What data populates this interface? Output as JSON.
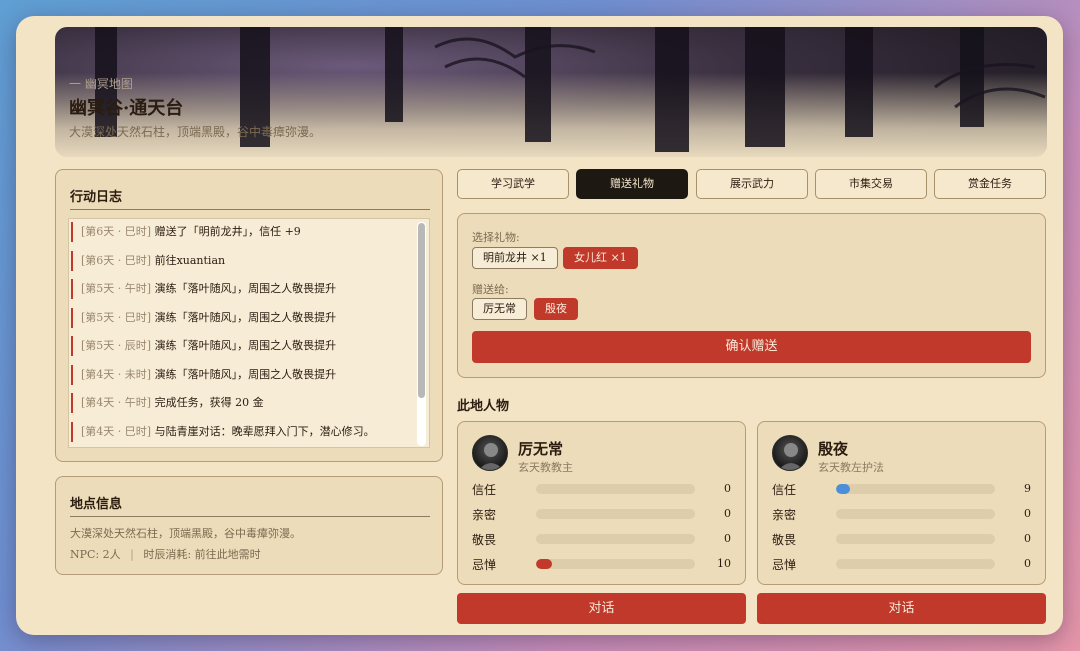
{
  "location": {
    "region": "一 幽冥地图",
    "title": "幽冥谷·通天台",
    "description": "大漠深处天然石柱，顶端黑殿，谷中毒瘴弥漫。"
  },
  "action_log": {
    "title": "行动日志",
    "entries": [
      {
        "time": "[第6天 · 巳时]",
        "text": "赠送了「明前龙井」，信任 +9"
      },
      {
        "time": "[第6天 · 巳时]",
        "text": "前往xuantian"
      },
      {
        "time": "[第5天 · 午时]",
        "text": "演练「落叶随风」，周围之人敬畏提升"
      },
      {
        "time": "[第5天 · 巳时]",
        "text": "演练「落叶随风」，周围之人敬畏提升"
      },
      {
        "time": "[第5天 · 辰时]",
        "text": "演练「落叶随风」，周围之人敬畏提升"
      },
      {
        "time": "[第4天 · 未时]",
        "text": "演练「落叶随风」，周围之人敬畏提升"
      },
      {
        "time": "[第4天 · 午时]",
        "text": "完成任务，获得 20 金"
      },
      {
        "time": "[第4天 · 巳时]",
        "text": "与陆青崖对话：晚辈愿拜入门下，潜心修习。"
      }
    ]
  },
  "location_info": {
    "title": "地点信息",
    "description": "大漠深处天然石柱，顶端黑殿，谷中毒瘴弥漫。",
    "npc_count": "NPC: 2人",
    "separator": "|",
    "time_cost": "时辰消耗: 前往此地需时"
  },
  "tabs": [
    {
      "label": "学习武学",
      "active": false
    },
    {
      "label": "赠送礼物",
      "active": true
    },
    {
      "label": "展示武力",
      "active": false
    },
    {
      "label": "市集交易",
      "active": false
    },
    {
      "label": "赏金任务",
      "active": false
    }
  ],
  "gift": {
    "select_label": "选择礼物:",
    "items": [
      {
        "label": "明前龙井 ×1",
        "selected": false
      },
      {
        "label": "女儿红 ×1",
        "selected": true
      }
    ],
    "target_label": "赠送给:",
    "targets": [
      {
        "label": "厉无常",
        "selected": false
      },
      {
        "label": "殷夜",
        "selected": true
      }
    ],
    "confirm_label": "确认赠送"
  },
  "npcs_title": "此地人物",
  "npcs": [
    {
      "name": "厉无常",
      "role": "玄天教教主",
      "talk_label": "对话",
      "stats": [
        {
          "label": "信任",
          "value": 0,
          "max": 100
        },
        {
          "label": "亲密",
          "value": 0,
          "max": 100
        },
        {
          "label": "敬畏",
          "value": 0,
          "max": 100
        },
        {
          "label": "忌惮",
          "value": 10,
          "max": 100
        }
      ]
    },
    {
      "name": "殷夜",
      "role": "玄天教左护法",
      "talk_label": "对话",
      "stats": [
        {
          "label": "信任",
          "value": 9,
          "max": 100
        },
        {
          "label": "亲密",
          "value": 0,
          "max": 100
        },
        {
          "label": "敬畏",
          "value": 0,
          "max": 100
        },
        {
          "label": "忌惮",
          "value": 0,
          "max": 100
        }
      ]
    }
  ],
  "colors": {
    "accent_red": "#c0392b",
    "trust_blue": "#4a8fd8",
    "panel_bg": "#eddcb9",
    "page_bg": "#f3e4c6"
  }
}
